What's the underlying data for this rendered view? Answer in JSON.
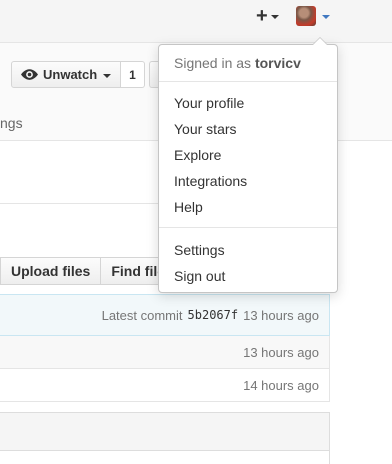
{
  "header": {
    "plus_label": "+",
    "avatar_icon": "user-avatar",
    "caret_color": "#4078c0"
  },
  "repo": {
    "watch_label": "Unwatch",
    "watch_count": "1",
    "settings_tab_partial": "ngs"
  },
  "file_nav": {
    "upload_label": "Upload files",
    "find_label": "Find file"
  },
  "commit": {
    "prefix": "Latest commit",
    "sha": "5b2067f",
    "time": "13 hours ago"
  },
  "files": [
    {
      "time": "13 hours ago"
    },
    {
      "time": "14 hours ago"
    }
  ],
  "dropdown": {
    "signed_in_prefix": "Signed in as",
    "username": "torvicv",
    "items": [
      "Your profile",
      "Your stars",
      "Explore",
      "Integrations",
      "Help"
    ],
    "items2": [
      "Settings",
      "Sign out"
    ]
  }
}
